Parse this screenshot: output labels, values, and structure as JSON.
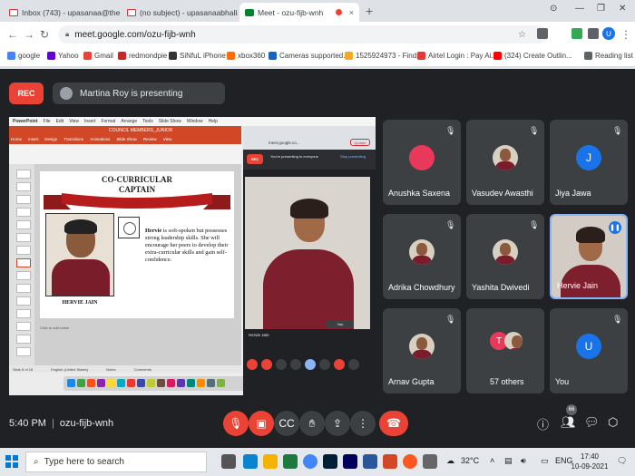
{
  "browser": {
    "tabs": [
      {
        "label": "Inbox (743) - upasanaa@theindi"
      },
      {
        "label": "(no subject) - upasanaabhalla13("
      },
      {
        "label": "Meet - ozu-fijb-wnh"
      }
    ],
    "url": "meet.google.com/ozu-fijb-wnh",
    "profile_initial": "U",
    "bookmarks": [
      {
        "label": "google",
        "color": "#4285f4"
      },
      {
        "label": "Yahoo",
        "color": "#6001d2"
      },
      {
        "label": "Gmail",
        "color": "#ea4335"
      },
      {
        "label": "redmondpie",
        "color": "#c62828"
      },
      {
        "label": "SiNfuL iPhone",
        "color": "#333333"
      },
      {
        "label": "xbox360",
        "color": "#ff6d00"
      },
      {
        "label": "Cameras supported...",
        "color": "#1565c0"
      },
      {
        "label": "1525924973 - Find...",
        "color": "#f9a825"
      },
      {
        "label": "Airtel Login : Pay Ai...",
        "color": "#e53935"
      },
      {
        "label": "(324) Create Outlin...",
        "color": "#ff0000"
      },
      {
        "label": "Reading list",
        "color": "#5f6368"
      }
    ]
  },
  "meet": {
    "rec_label": "REC",
    "presenter_text": "Martina Roy is presenting",
    "meeting_code": "ozu-fijb-wnh",
    "time": "5:40 PM",
    "participants_count": "66"
  },
  "shared_screen": {
    "mac_menu": [
      "PowerPoint",
      "File",
      "Edit",
      "View",
      "Insert",
      "Format",
      "Arrange",
      "Tools",
      "Slide Show",
      "Window",
      "Help"
    ],
    "ppt_title": "COUNCIL MEMBERS_JUNIOR",
    "ribbon_tabs": [
      "Home",
      "Insert",
      "Design",
      "Transitions",
      "Animations",
      "Slide Show",
      "Review",
      "View"
    ],
    "slide": {
      "title_line1": "CO-CURRICULAR",
      "title_line2": "CAPTAIN",
      "name": "HERVIE JAIN",
      "body_bold": "Hervie",
      "body_rest": " is soft-spoken but possesses strong leadership skills. She will encourage her peers to develop their extra-curricular skills and gain self-confidence."
    },
    "notes_hint": "Click to add notes",
    "status": [
      "Slide 8 of 18",
      "English (United States)",
      "Notes",
      "Comments"
    ],
    "mini_url": "meet.google.co...",
    "mini_update": "Update",
    "mini_rec": "REC",
    "mini_presenting": "You're presenting to everyone",
    "mini_stop": "Stop presenting",
    "mini_you": "You",
    "mini_name": "Hervie Jain"
  },
  "tiles": [
    {
      "name": "Anushka Saxena",
      "color": "#e8395a"
    },
    {
      "name": "Vasudev Awasthi",
      "color": "#d8cfc3"
    },
    {
      "name": "Jiya Jawa",
      "initial": "J",
      "color": "#1a73e8"
    },
    {
      "name": "Adrika Chowdhury",
      "color": "#d8cfc3"
    },
    {
      "name": "Yashita Dwivedi",
      "color": "#d8cfc3"
    },
    {
      "name": "Hervie Jain"
    },
    {
      "name": "Arnav Gupta",
      "color": "#d8cfc3"
    },
    {
      "name": "57 others",
      "initial": "T",
      "color": "#e8395a"
    },
    {
      "name": "You",
      "initial": "U",
      "color": "#1a73e8"
    }
  ],
  "taskbar": {
    "search_placeholder": "Type here to search",
    "weather": "32°C",
    "lang": "ENG",
    "time": "17:40",
    "date": "10-09-2021"
  }
}
